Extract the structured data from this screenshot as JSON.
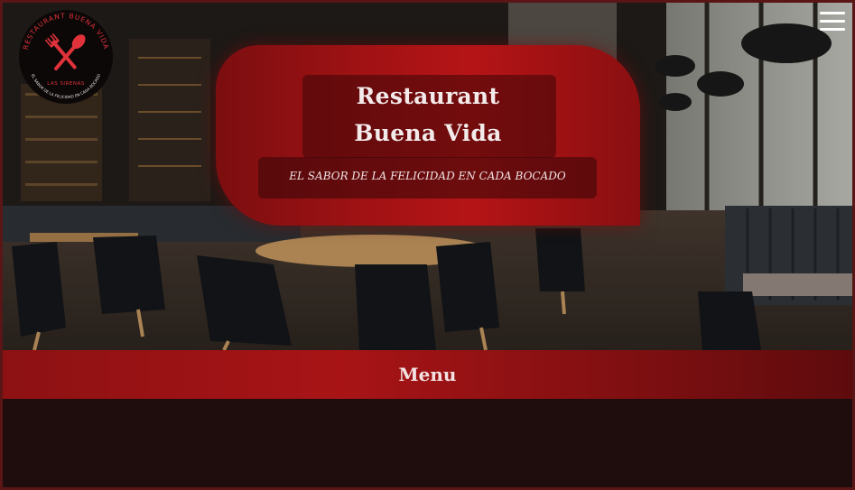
{
  "header": {
    "title_line1": "Restaurant",
    "title_line2": "Buena Vida",
    "tagline": "EL SABOR DE LA FELICIDAD EN CADA BOCADO"
  },
  "logo": {
    "top_text": "RESTAURANT BUENA VIDA",
    "location": "LAS SIRENAS",
    "bottom_text": "EL SABOR DE LA FELICIDAD EN CADA BOCADO",
    "icon": "fork-spoon-crossed-icon",
    "accent_color": "#e0323a"
  },
  "nav": {
    "menu_icon": "hamburger-menu-icon"
  },
  "menu_bar": {
    "label": "Menu"
  },
  "colors": {
    "brand_red": "#a81416",
    "dark_background": "#1f0d0d",
    "title_text": "#f3eaea"
  }
}
